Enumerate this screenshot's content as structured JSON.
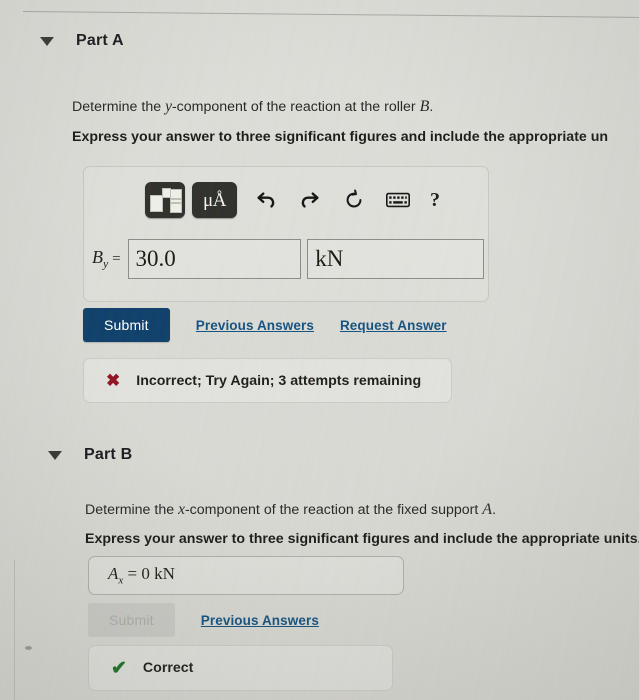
{
  "theme": {
    "background": "#d9d9d3",
    "submit_button_bg": "#0e3a63",
    "submit_button_disabled_bg": "#c6c6c0",
    "link_color": "#124b78",
    "incorrect_mark_color": "#8c1220",
    "correct_mark_color": "#1b6b22",
    "toolbar_button_bg": "#2b2b26"
  },
  "part_a": {
    "caret_icon": "caret-down-icon",
    "title": "Part A",
    "question_prefix": "Determine the ",
    "question_var": "y",
    "question_middle": "-component of the reaction at the roller ",
    "question_var2": "B",
    "question_suffix": ".",
    "instruction": "Express your answer to three significant figures and include the appropriate un",
    "toolbar": {
      "template_button": "math-template-icon",
      "units_button_label": "μÅ",
      "undo_icon": "undo-arrow-icon",
      "redo_icon": "redo-arrow-icon",
      "reset_icon": "reset-circular-arrow-icon",
      "keyboard_icon": "keyboard-icon",
      "help_label": "?"
    },
    "answer": {
      "lhs_symbol": "B",
      "lhs_subscript": "y",
      "equals": "=",
      "value": "30.0",
      "value_placeholder": "",
      "units": "kN",
      "units_placeholder": ""
    },
    "submit_label": "Submit",
    "previous_answers_label": "Previous Answers",
    "request_answer_label": "Request Answer",
    "feedback": {
      "mark": "✖",
      "message": "Incorrect; Try Again; 3 attempts remaining"
    }
  },
  "part_b": {
    "caret_icon": "caret-down-icon",
    "title": "Part B",
    "question_prefix": "Determine the ",
    "question_var": "x",
    "question_middle": "-component of the reaction at the fixed support ",
    "question_var2": "A",
    "question_suffix": ".",
    "instruction": "Express your answer to three significant figures and include the appropriate units.",
    "answer": {
      "lhs_symbol": "A",
      "lhs_subscript": "x",
      "equals": "=",
      "value": "0",
      "units": "kN"
    },
    "submit_label": "Submit",
    "submit_disabled": true,
    "previous_answers_label": "Previous Answers",
    "feedback": {
      "mark": "✔",
      "message": "Correct"
    }
  }
}
